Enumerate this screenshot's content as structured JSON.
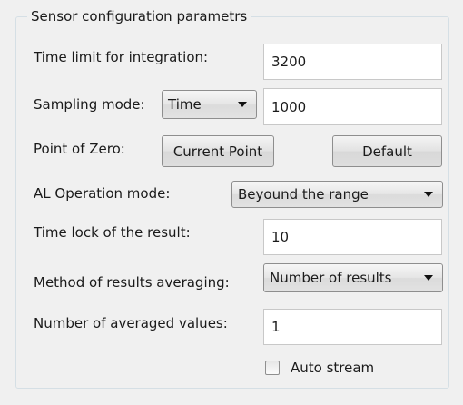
{
  "group": {
    "title": "Sensor configuration parametrs"
  },
  "time_limit": {
    "label": "Time limit for integration:",
    "value": "3200"
  },
  "sampling": {
    "label": "Sampling mode:",
    "mode": "Time",
    "value": "1000"
  },
  "zero": {
    "label": "Point of Zero:",
    "current_button": "Current Point",
    "default_button": "Default"
  },
  "al_mode": {
    "label": "AL Operation mode:",
    "value": "Beyound the range"
  },
  "time_lock": {
    "label": "Time lock of the result:",
    "value": "10"
  },
  "averaging": {
    "label": "Method of results averaging:",
    "value": "Number of results"
  },
  "averaged_count": {
    "label": "Number of averaged values:",
    "value": "1"
  },
  "auto_stream": {
    "label": "Auto stream",
    "checked": false
  }
}
